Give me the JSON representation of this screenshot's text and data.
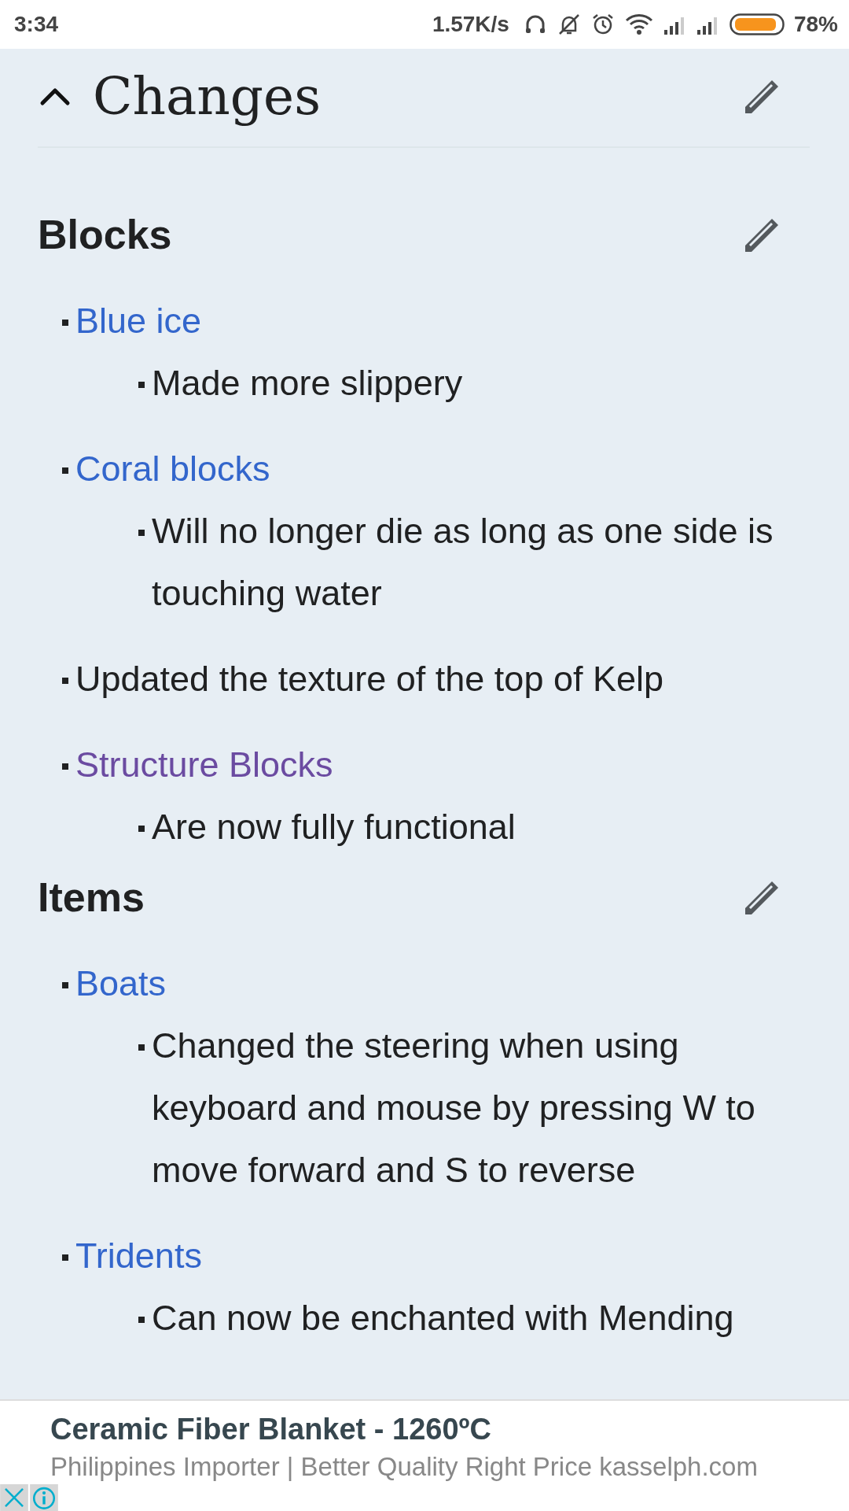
{
  "status_bar": {
    "time": "3:34",
    "speed": "1.57K/s",
    "battery": "78%"
  },
  "page_section": {
    "title": "Changes",
    "expanded": true
  },
  "sections": [
    {
      "title": "Blocks",
      "items": [
        {
          "kind": "link",
          "text": "Blue ice",
          "children": [
            {
              "text": "Made more slippery"
            }
          ]
        },
        {
          "kind": "link",
          "text": "Coral blocks",
          "children": [
            {
              "text": "Will no longer die as long as one side is touching water"
            }
          ]
        },
        {
          "kind": "text",
          "text": "Updated the texture of the top of Kelp"
        },
        {
          "kind": "visited-link",
          "text": "Structure Blocks",
          "children": [
            {
              "text": "Are now fully functional"
            }
          ]
        }
      ]
    },
    {
      "title": "Items",
      "items": [
        {
          "kind": "link",
          "text": "Boats",
          "children": [
            {
              "text": "Changed the steering when using keyboard and mouse by pressing W to move forward and S to reverse"
            }
          ]
        },
        {
          "kind": "link",
          "text": "Tridents",
          "children": [
            {
              "text": "Can now be enchanted with Mending"
            }
          ]
        }
      ]
    }
  ],
  "ad": {
    "title": "Ceramic Fiber Blanket - 1260ºC",
    "description": "Philippines Importer | Better Quality Right Price kasselph.com"
  }
}
